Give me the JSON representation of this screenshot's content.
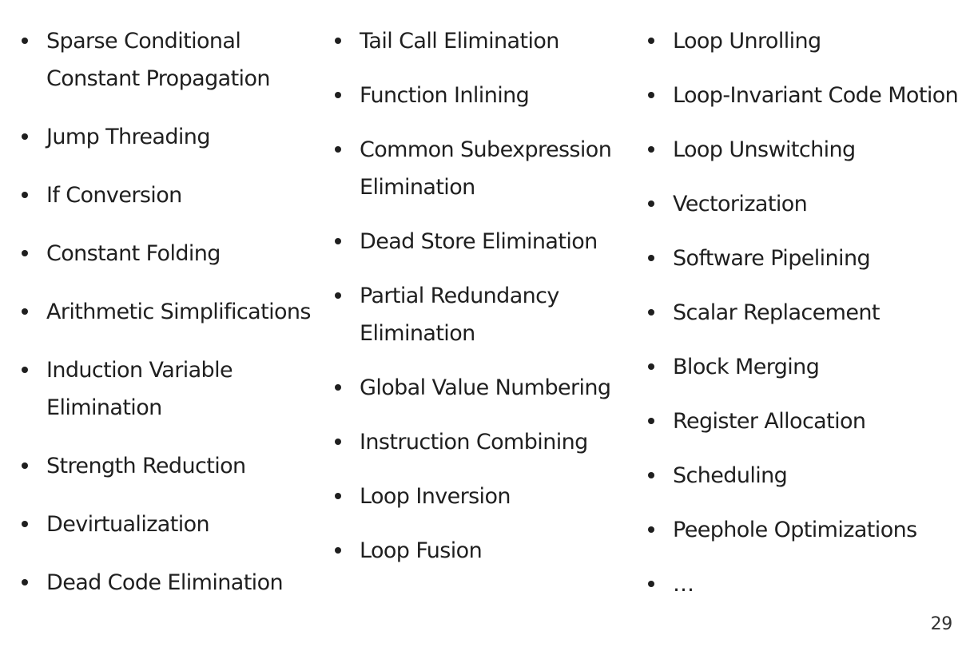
{
  "columns": [
    {
      "items": [
        "Sparse Conditional Constant Propagation",
        "Jump Threading",
        "If Conversion",
        "Constant Folding",
        "Arithmetic Simplifications",
        "Induction Variable Elimination",
        "Strength Reduction",
        "Devirtualization",
        "Dead Code Elimination"
      ]
    },
    {
      "items": [
        "Tail Call Elimination",
        "Function Inlining",
        "Common Subexpression Elimination",
        "Dead Store Elimination",
        "Partial Redundancy Elimination",
        "Global Value Numbering",
        "Instruction Combining",
        "Loop Inversion",
        "Loop Fusion"
      ]
    },
    {
      "items": [
        "Loop Unrolling",
        "Loop-Invariant Code Motion",
        "Loop Unswitching",
        "Vectorization",
        "Software Pipelining",
        "Scalar Replacement",
        "Block Merging",
        "Register Allocation",
        "Scheduling",
        "Peephole Optimizations",
        "…"
      ]
    }
  ],
  "page_number": "29"
}
